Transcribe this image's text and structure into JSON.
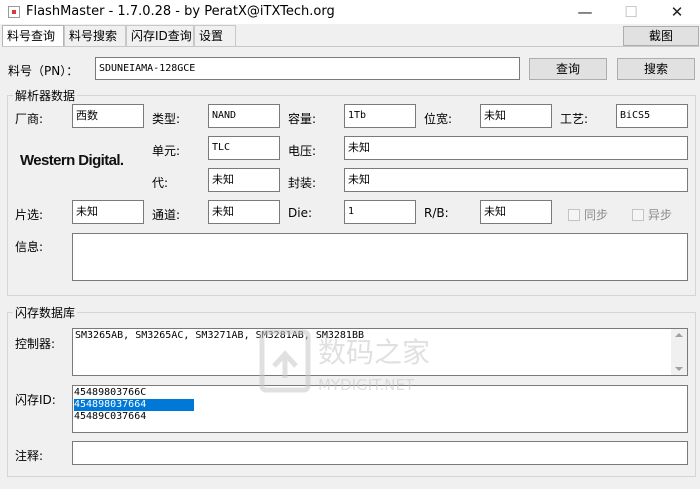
{
  "window": {
    "title": "FlashMaster - 1.7.0.28 - by PeratX@iTXTech.org",
    "min_glyph": "—",
    "max_glyph": "☐",
    "close_glyph": "✕"
  },
  "tabs": [
    {
      "label": "料号查询",
      "active": true
    },
    {
      "label": "料号搜索",
      "active": false
    },
    {
      "label": "闪存ID查询",
      "active": false
    },
    {
      "label": "设置",
      "active": false
    }
  ],
  "toolbar": {
    "screenshot_label": "截图"
  },
  "query": {
    "pn_label": "料号（PN）：",
    "pn_value": "SDUNEIAMA-128GCE",
    "query_button": "查询",
    "search_button": "搜索"
  },
  "parser": {
    "title": "解析器数据",
    "vendor_label": "厂商:",
    "vendor_value": "西数",
    "type_label": "类型:",
    "type_value": "NAND",
    "capacity_label": "容量:",
    "capacity_value": "1Tb",
    "width_label": "位宽:",
    "width_value": "未知",
    "process_label": "工艺:",
    "process_value": "BiCS5",
    "logo_text": "Western Digital.",
    "cell_label": "单元:",
    "cell_value": "TLC",
    "voltage_label": "电压:",
    "voltage_value": "未知",
    "gen_label": "代:",
    "gen_value": "未知",
    "package_label": "封装:",
    "package_value": "未知",
    "ce_label": "片选:",
    "ce_value": "未知",
    "channel_label": "通道:",
    "channel_value": "未知",
    "die_label": "Die:",
    "die_value": "1",
    "rb_label": "R/B:",
    "rb_value": "未知",
    "sync_label": "同步",
    "async_label": "异步",
    "info_label": "信息:",
    "info_value": ""
  },
  "database": {
    "title": "闪存数据库",
    "controller_label": "控制器:",
    "controller_value": "SM3265AB, SM3265AC, SM3271AB, SM3281AB, SM3281BB",
    "flash_id_label": "闪存ID:",
    "flash_ids": [
      "45489803766C",
      "454898037664",
      "45489C037664"
    ],
    "selected_index": 1,
    "note_label": "注释:",
    "note_value": ""
  },
  "watermark": {
    "line1": "数码之家",
    "line2": "MYDIGIT.NET"
  },
  "colors": {
    "selection": "#0078d7",
    "window_bg": "#f0f0f0"
  }
}
